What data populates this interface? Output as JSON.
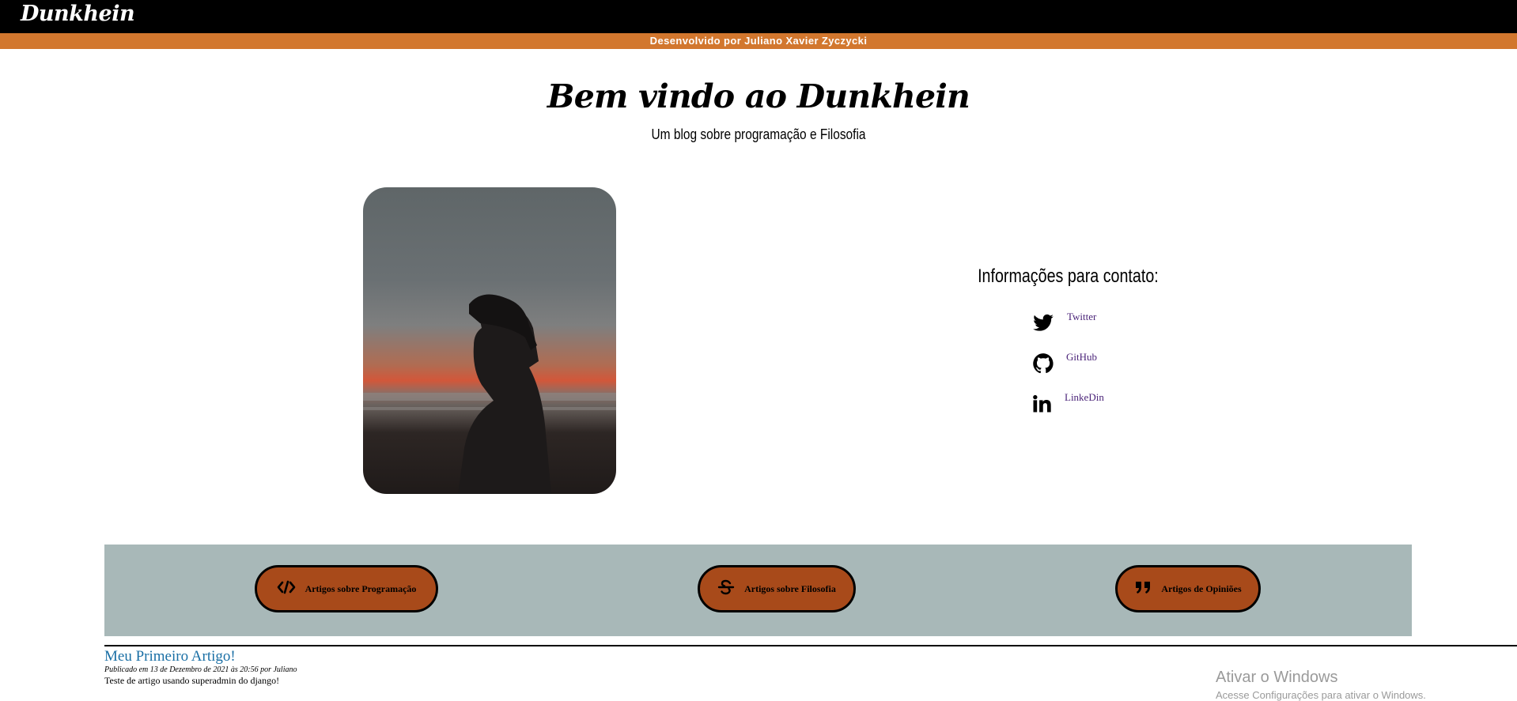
{
  "header": {
    "logo": "Dunkhein",
    "developer_line": "Desenvolvido por Juliano Xavier Zyczycki"
  },
  "hero": {
    "title": "Bem vindo ao Dunkhein",
    "subtitle": "Um blog sobre programação e Filosofia"
  },
  "contact": {
    "title": "Informações para contato:",
    "links": [
      {
        "label": "Twitter",
        "icon": "twitter-icon"
      },
      {
        "label": "GitHub",
        "icon": "github-icon"
      },
      {
        "label": "LinkeDin",
        "icon": "linkedin-icon"
      }
    ]
  },
  "categories": [
    {
      "label": "Artigos sobre Programação",
      "icon": "code-icon"
    },
    {
      "label": "Artigos sobre Filosofia",
      "icon": "strikethrough-icon"
    },
    {
      "label": "Artigos de Opiniões",
      "icon": "quote-icon"
    }
  ],
  "article": {
    "title": "Meu Primeiro Artigo!",
    "meta": "Publicado em 13 de Dezembro de 2021 às 20:56 por Juliano",
    "body": "Teste de artigo usando superadmin do django!"
  },
  "watermark": {
    "title": "Ativar o Windows",
    "subtitle": "Acesse Configurações para ativar o Windows."
  },
  "colors": {
    "topbar": "#000000",
    "devbar": "#d2772e",
    "category_bar": "#a8b8b8",
    "category_button": "#a84a1a",
    "link": "#4b2479",
    "article_title": "#1a6fa5"
  }
}
